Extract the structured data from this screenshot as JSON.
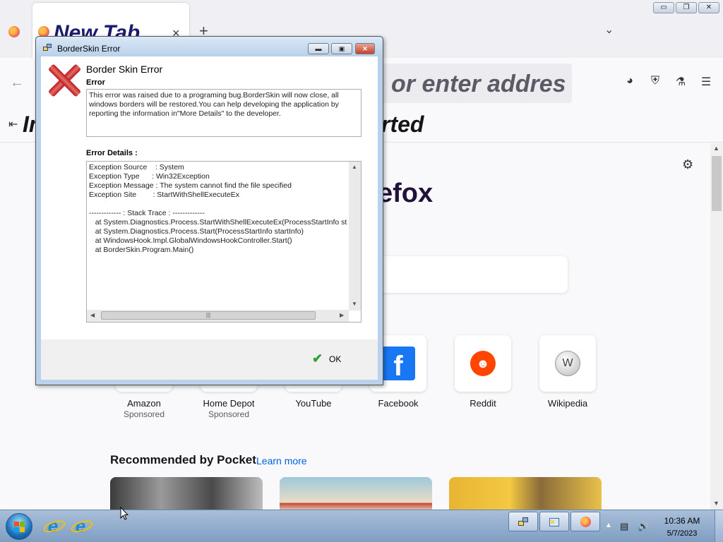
{
  "colors": {
    "firefox_bg": "#f9f9fb",
    "dialog_frame": "#b9d1ea",
    "error_red": "#c3422b",
    "link_blue": "#0061e0",
    "taskbar": "#7f9dc2"
  },
  "firefox": {
    "tab_title": "New Tab",
    "tab_close": "×",
    "new_tab": "+",
    "tab_list": "⌄",
    "window_controls": {
      "minimize": "▭",
      "restore": "❐",
      "close": "✕"
    },
    "url_placeholder_visible": "or enter addres",
    "bookmark_left": "Im",
    "bookmark_right": "rted",
    "brand_partial": "efox",
    "shortcuts": [
      {
        "name": "Amazon",
        "sub": "Sponsored"
      },
      {
        "name": "Home Depot",
        "sub": "Sponsored"
      },
      {
        "name": "YouTube",
        "sub": ""
      },
      {
        "name": "Facebook",
        "sub": ""
      },
      {
        "name": "Reddit",
        "sub": ""
      },
      {
        "name": "Wikipedia",
        "sub": ""
      }
    ],
    "pocket_title": "Recommended by Pocket",
    "pocket_link": "Learn more",
    "icons": [
      "back-arrow-icon",
      "pocket-icon",
      "ublock-icon",
      "extensions-icon",
      "menu-icon",
      "gear-icon"
    ]
  },
  "dialog": {
    "title": "BorderSkin Error",
    "heading": "Border Skin Error",
    "error_label": "Error",
    "error_message": "This error was raised due to a programing bug.BorderSkin will now close, all\nwindows borders will be restored.You can help developing the application by\nreporting the information in\"More Details\" to the developer.",
    "details_label": "Error Details :",
    "details_lines": [
      "Exception Source    : System",
      "Exception Type      : Win32Exception",
      "Exception Message : The system cannot find the file specified",
      "Exception Site        : StartWithShellExecuteEx",
      "",
      "------------- : Stack Trace : -------------",
      "   at System.Diagnostics.Process.StartWithShellExecuteEx(ProcessStartInfo st",
      "   at System.Diagnostics.Process.Start(ProcessStartInfo startInfo)",
      "   at WindowsHook.Impl.GlobalWindowsHookController.Start()",
      "   at BorderSkin.Program.Main()"
    ],
    "ok_label": "OK",
    "buttons": {
      "minimize": "▬",
      "maximize": "▣",
      "close": "✕"
    }
  },
  "taskbar": {
    "time": "10:36 AM",
    "date": "5/7/2023",
    "tray_arrow": "▲"
  }
}
